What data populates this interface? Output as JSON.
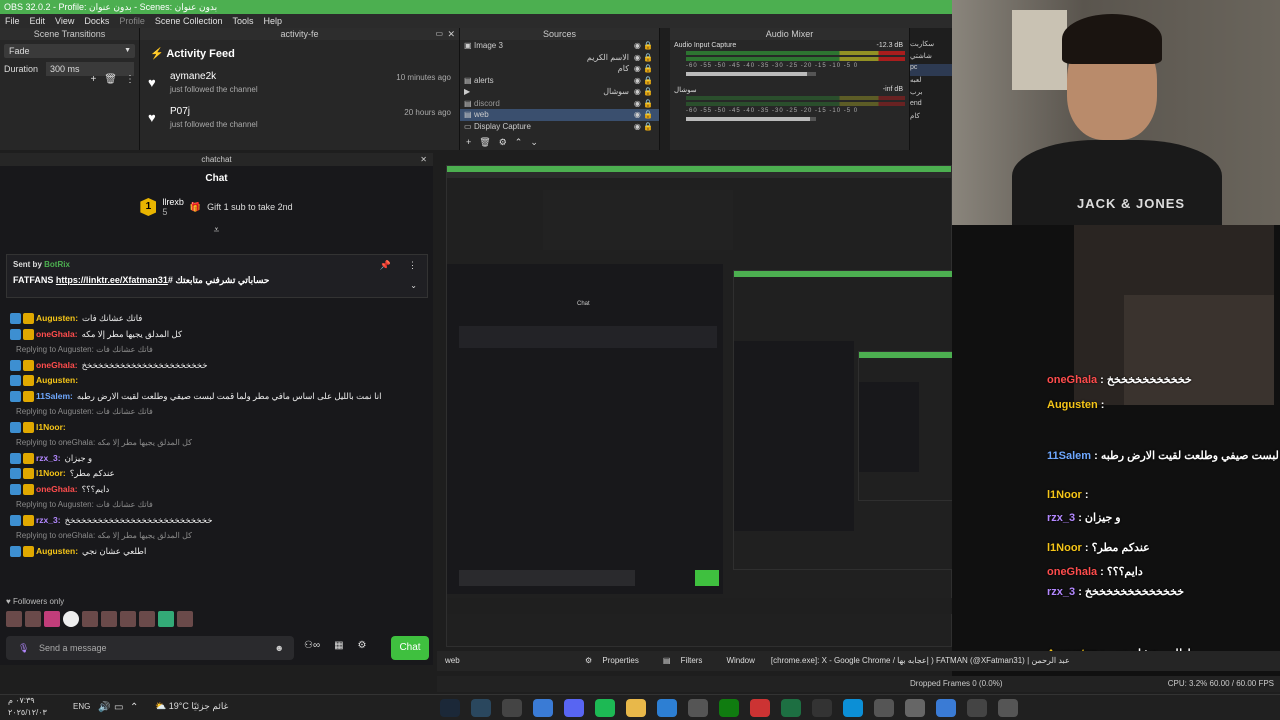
{
  "window": {
    "title": "OBS 32.0.2 - Profile: بدون عنوان - Scenes: بدون عنوان",
    "menu": [
      "File",
      "Edit",
      "View",
      "Docks",
      "Profile",
      "Scene Collection",
      "Tools",
      "Help"
    ]
  },
  "scene_transitions": {
    "header": "Scene Transitions",
    "transition": "Fade",
    "duration_label": "Duration",
    "duration_value": "300 ms"
  },
  "activity_feed": {
    "header": "activity-fe",
    "title": "Activity Feed",
    "items": [
      {
        "name": "aymane2k",
        "action": "just followed the channel",
        "time": "10 minutes ago"
      },
      {
        "name": "P07j",
        "action": "just followed the channel",
        "time": "20 hours ago"
      }
    ]
  },
  "sources": {
    "header": "Sources",
    "items": [
      {
        "label": "Image 3",
        "selected": false
      },
      {
        "label": "الاسم الكريم",
        "selected": false
      },
      {
        "label": "كام",
        "selected": false
      },
      {
        "label": "alerts",
        "selected": false
      },
      {
        "label": "سوشال",
        "selected": false
      },
      {
        "label": "discord",
        "selected": false
      },
      {
        "label": "web",
        "selected": true
      },
      {
        "label": "Display Capture",
        "selected": false
      }
    ]
  },
  "audio_mixer": {
    "header": "Audio Mixer",
    "channels": [
      {
        "name": "Audio Input Capture",
        "db": "-12.3 dB",
        "level": 0.78,
        "volume": 0.93
      },
      {
        "name": "سوشال",
        "db": "-inf dB",
        "level": 0.0,
        "volume": 0.95
      }
    ],
    "scale": "-60 -55 -50 -45 -40 -35 -30 -25 -20 -15 -10 -5 0",
    "scenes_side": [
      "سكاربت",
      "شاشتي",
      "pc",
      "لعبه",
      "برب",
      "end",
      "كام"
    ],
    "active_scene": "pc"
  },
  "chat": {
    "header": "chatchat",
    "title": "Chat",
    "sub_user": "llrexb",
    "sub_count": "5",
    "sub_text": "Gift 1 sub to take 2nd",
    "pinned": {
      "sent_by_label": "Sent by",
      "bot": "BotRix",
      "text": "حساباتي تشرفني متابعتك #FATFANS",
      "link": "https://linktr.ee/Xfatman31"
    },
    "messages": [
      {
        "type": "msg",
        "user": "Augusten:",
        "color": "gold",
        "text": "فاتك عشانك فات"
      },
      {
        "type": "msg",
        "user": "oneGhala:",
        "color": "red",
        "text": "كل المدلق يجيها مطر إلا مكه"
      },
      {
        "type": "reply",
        "text": "Replying to Augusten: فاتك عشانك فات"
      },
      {
        "type": "msg",
        "user": "oneGhala:",
        "color": "red",
        "text": "خخخخخخخخخخخخخخخخخخخخخخخ"
      },
      {
        "type": "msg",
        "user": "Augusten:",
        "color": "gold",
        "text": ""
      },
      {
        "type": "msg",
        "user": "11Salem:",
        "color": "blue",
        "text": "انا نمت بالليل على اساس مافي مطر ولما قمت لبست صيفي وطلعت لقيت الارض رطبه"
      },
      {
        "type": "reply",
        "text": "Replying to Augusten: فاتك عشانك فات"
      },
      {
        "type": "msg",
        "user": "l1Noor:",
        "color": "gold",
        "text": ""
      },
      {
        "type": "reply",
        "text": "Replying to oneGhala: كل المدلق يجيها مطر إلا مكه"
      },
      {
        "type": "msg",
        "user": "rzx_3:",
        "color": "purple",
        "text": "و جيزان"
      },
      {
        "type": "msg",
        "user": "l1Noor:",
        "color": "gold",
        "text": "عندكم مطر؟"
      },
      {
        "type": "msg",
        "user": "oneGhala:",
        "color": "red",
        "text": "دايم؟؟؟"
      },
      {
        "type": "reply",
        "text": "Replying to Augusten: فاتك عشانك فات"
      },
      {
        "type": "msg",
        "user": "rzx_3:",
        "color": "purple",
        "text": "خخخخخخخخخخخخخخخخخخخخخخخخخخخ"
      },
      {
        "type": "reply",
        "text": "Replying to oneGhala: كل المدلق يجيها مطر إلا مكه"
      },
      {
        "type": "msg",
        "user": "Augusten:",
        "color": "gold",
        "text": "اطلعي عشان نجي"
      }
    ],
    "followers_only": "Followers only",
    "send_placeholder": "Send a message",
    "chat_button": "Chat"
  },
  "overlay": {
    "brand": "JACK & JONES",
    "messages": [
      {
        "user": "oneGhala",
        "text": "خخخخخخخخخخخخ"
      },
      {
        "user": "Augusten",
        "text": ""
      },
      {
        "user": "11Salem",
        "text": "انا نمت بالليل على اساس مافي مطر ولما قمت لبست صيفي وطلعت لقيت الارض رطبه"
      },
      {
        "user": "l1Noor",
        "text": ""
      },
      {
        "user": "rzx_3",
        "text": "و جيزان"
      },
      {
        "user": "l1Noor",
        "text": "عندكم مطر؟"
      },
      {
        "user": "oneGhala",
        "text": "دايم؟؟؟"
      },
      {
        "user": "rzx_3",
        "text": "خخخخخخخخخخخخخخ"
      },
      {
        "user": "Augusten",
        "text": "اطلعي عشان نجي"
      }
    ]
  },
  "controls": {
    "source_name": "web",
    "properties": "Properties",
    "filters": "Filters",
    "window_label": "Window",
    "window_value": "[chrome.exe]: X - Google Chrome / إعجابه بها ) FATMAN (@XFatman31) | عبد الرحمن"
  },
  "status": {
    "dropped": "Dropped Frames 0 (0.0%)",
    "cpu": "CPU: 3.2% 60.00 / 60.00 FPS"
  },
  "taskbar": {
    "time": "٠٧:٣٩ م",
    "date": "٢٠٢٥/١٢/٠٣",
    "lang": "ENG",
    "temp": "19°C",
    "weather_text": "غائم جزئيًا"
  }
}
